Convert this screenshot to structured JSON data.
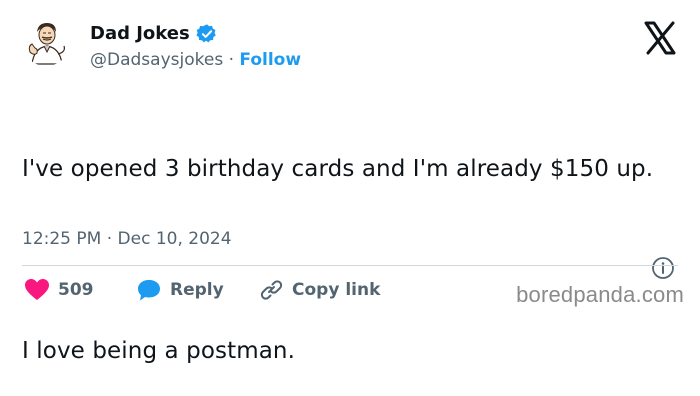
{
  "author": {
    "display_name": "Dad Jokes",
    "handle": "@Dadsaysjokes",
    "separator": "·",
    "follow_label": "Follow",
    "verified_color": "#1d9bf0"
  },
  "tweet": {
    "line1": "I've opened 3 birthday cards and I'm already $150 up.",
    "line2": "I love being a postman.",
    "timestamp": "12:25 PM · Dec 10, 2024"
  },
  "actions": {
    "like_count": "509",
    "like_color": "#f91880",
    "reply_label": "Reply",
    "reply_color": "#1d9bf0",
    "copy_label": "Copy link"
  },
  "watermark": "boredpanda.com",
  "icons": [
    "avatar-cartoon-dad",
    "verified-badge-icon",
    "x-logo-icon",
    "info-icon",
    "heart-icon",
    "reply-bubble-icon",
    "link-icon"
  ]
}
